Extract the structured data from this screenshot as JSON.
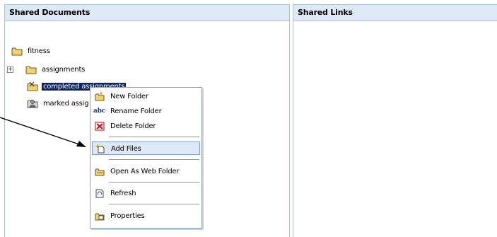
{
  "panels": {
    "left_title": "Shared Documents",
    "right_title": "Shared Links"
  },
  "tree": {
    "root": "fitness",
    "items": [
      {
        "label": "assignments",
        "icon": "folder-icon",
        "expandable": true
      },
      {
        "label": "completed assignments",
        "icon": "folder-shared-icon",
        "selected": true
      },
      {
        "label": "marked assig",
        "icon": "folder-user-icon"
      }
    ]
  },
  "context_menu": {
    "items": [
      {
        "label": "New Folder",
        "icon": "new-folder-icon"
      },
      {
        "label": "Rename Folder",
        "icon": "abc-rename-icon"
      },
      {
        "label": "Delete Folder",
        "icon": "delete-icon"
      },
      {
        "label": "Add Files",
        "icon": "add-file-icon",
        "highlighted": true
      },
      {
        "label": "Open As Web Folder",
        "icon": "web-folder-icon"
      },
      {
        "label": "Refresh",
        "icon": "refresh-icon"
      },
      {
        "label": "Properties",
        "icon": "properties-icon"
      }
    ],
    "rename_glyph": "abc"
  },
  "colors": {
    "header_bg": "#dde9f5",
    "selection": "#0a246a",
    "menu_highlight": "#dfe8f6",
    "folder_yellow": "#f3d26a"
  }
}
